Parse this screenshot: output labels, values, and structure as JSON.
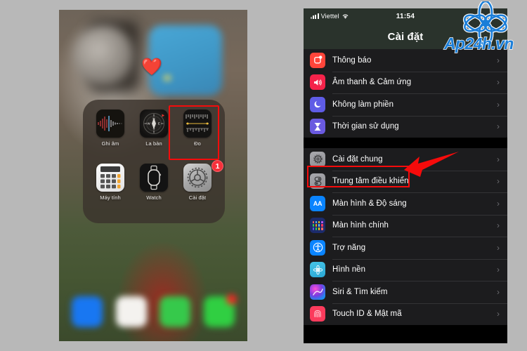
{
  "background_color": "#b8b8b8",
  "left_phone": {
    "name": "iphone-home-screen",
    "wallpaper_emoji": "❤️",
    "folder": {
      "apps": [
        {
          "label": "Ghi âm",
          "icon": "voice-memos-icon",
          "badge": null
        },
        {
          "label": "La bàn",
          "icon": "compass-icon",
          "badge": null
        },
        {
          "label": "Đo",
          "icon": "measure-icon",
          "badge": null
        },
        {
          "label": "Máy tính",
          "icon": "calculator-icon",
          "badge": null
        },
        {
          "label": "Watch",
          "icon": "watch-icon",
          "badge": null
        },
        {
          "label": "Cài đặt",
          "icon": "settings-gear-icon",
          "badge": "1"
        }
      ]
    },
    "dock": [
      {
        "name": "facebook-app-icon",
        "color": "#1877f2",
        "badge": false
      },
      {
        "name": "safari-app-icon",
        "color": "#f4f2ef",
        "badge": false
      },
      {
        "name": "phone-app-icon",
        "color": "#36c94b",
        "badge": false
      },
      {
        "name": "messages-app-icon",
        "color": "#30cf42",
        "badge": true
      }
    ],
    "highlight_color": "#f60b0b"
  },
  "right_phone": {
    "name": "iphone-settings-screen",
    "status_bar": {
      "carrier": "Viettel",
      "time": "11:54",
      "wifi_icon": "wifi-icon",
      "signal_icon": "cellular-signal-icon",
      "lock_icon": "rotation-lock-icon",
      "battery_icon": "battery-icon"
    },
    "nav_title": "Cài đặt",
    "groups": [
      {
        "name": "notifications-group",
        "rows": [
          {
            "label": "Thông báo",
            "icon": "notifications-icon",
            "icon_class": "i-notif",
            "glyph": "▢"
          },
          {
            "label": "Âm thanh & Cảm ứng",
            "icon": "sounds-haptics-icon",
            "icon_class": "i-sound",
            "glyph": "🔊"
          },
          {
            "label": "Không làm phiền",
            "icon": "do-not-disturb-icon",
            "icon_class": "i-dnd",
            "glyph": "🌙"
          },
          {
            "label": "Thời gian sử dụng",
            "icon": "screen-time-icon",
            "icon_class": "i-screen",
            "glyph": "⏳"
          }
        ]
      },
      {
        "name": "general-group",
        "rows": [
          {
            "label": "Cài đặt chung",
            "icon": "general-gear-icon",
            "icon_class": "i-general",
            "glyph": "⚙"
          },
          {
            "label": "Trung tâm điều khiển",
            "icon": "control-center-icon",
            "icon_class": "i-control",
            "glyph": "⚟"
          },
          {
            "label": "Màn hình & Độ sáng",
            "icon": "display-brightness-icon",
            "icon_class": "i-display",
            "glyph": "AA"
          },
          {
            "label": "Màn hình chính",
            "icon": "home-screen-icon",
            "icon_class": "i-home",
            "glyph": "▦"
          },
          {
            "label": "Trợ năng",
            "icon": "accessibility-icon",
            "icon_class": "i-access",
            "glyph": "♿"
          },
          {
            "label": "Hình nền",
            "icon": "wallpaper-icon",
            "icon_class": "i-wall",
            "glyph": "✿"
          },
          {
            "label": "Siri & Tìm kiếm",
            "icon": "siri-search-icon",
            "icon_class": "i-siri",
            "glyph": "◉"
          },
          {
            "label": "Touch ID & Mật mã",
            "icon": "touch-id-icon",
            "icon_class": "i-touchid",
            "glyph": "☝"
          }
        ]
      }
    ],
    "chevron": "›",
    "highlighted_row": "Cài đặt chung",
    "highlight_color": "#f60b0b",
    "arrow_color": "#f60b0b"
  },
  "watermark": {
    "text": "Ap24h.vn",
    "logo": "flower-logo-icon",
    "color": "#1b7ed8"
  }
}
